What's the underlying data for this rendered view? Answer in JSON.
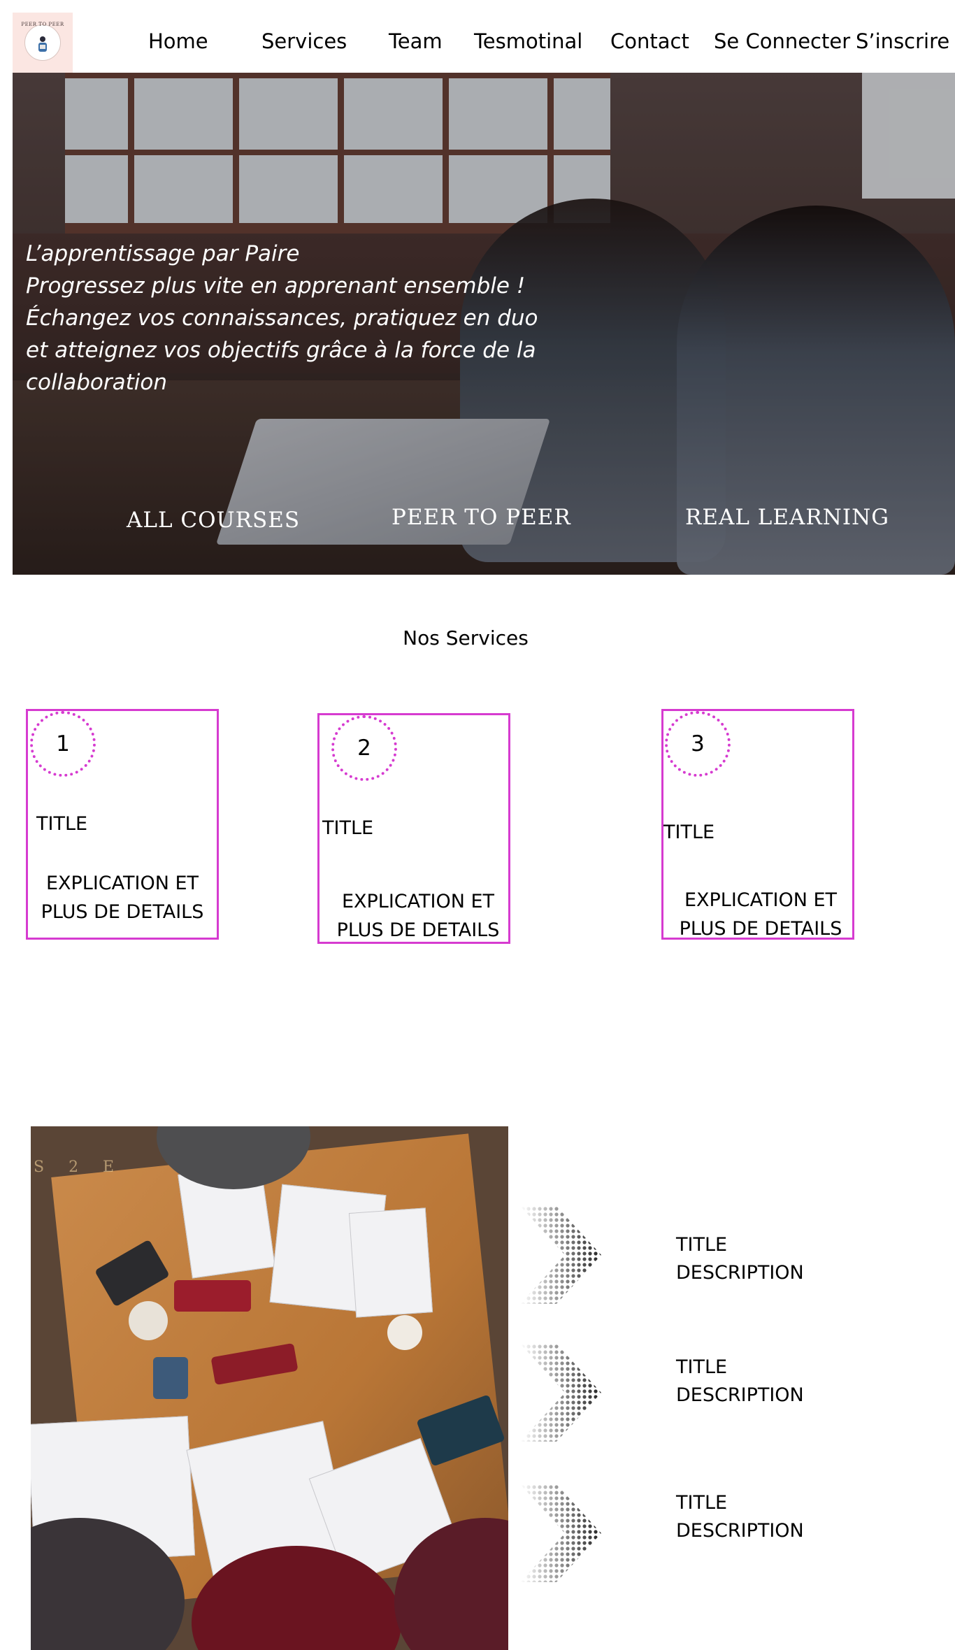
{
  "brand": {
    "logo_text": "PEER TO PEER",
    "accent_color": "#d63bd0"
  },
  "nav": {
    "links": [
      "Home",
      "Services",
      "Team",
      "Tesmotinal",
      "Contact",
      "Se Connecter",
      "S’inscrire"
    ]
  },
  "hero": {
    "lines": [
      "L’apprentissage par Paire",
      "Progressez plus vite en apprenant ensemble !",
      " Échangez vos connaissances, pratiquez en duo",
      "et atteignez vos objectifs grâce à la force de la",
      "collaboration"
    ],
    "ctas": [
      "ALL COURSES",
      "PEER TO PEER",
      "REAL LEARNING"
    ]
  },
  "services": {
    "title": "Nos Services",
    "cards": [
      {
        "number": "1",
        "title": "TITLE",
        "desc_line1": "EXPLICATION ET",
        "desc_line2": "PLUS DE DETAILS"
      },
      {
        "number": "2",
        "title": "TITLE",
        "desc_line1": "EXPLICATION ET",
        "desc_line2": "PLUS DE DETAILS"
      },
      {
        "number": "3",
        "title": "TITLE",
        "desc_line1": "EXPLICATION ET",
        "desc_line2": "PLUS DE DETAILS"
      }
    ]
  },
  "features": {
    "items": [
      {
        "title": "TITLE",
        "description": "DESCRIPTION"
      },
      {
        "title": "TITLE",
        "description": "DESCRIPTION"
      },
      {
        "title": "TITLE",
        "description": "DESCRIPTION"
      }
    ]
  }
}
